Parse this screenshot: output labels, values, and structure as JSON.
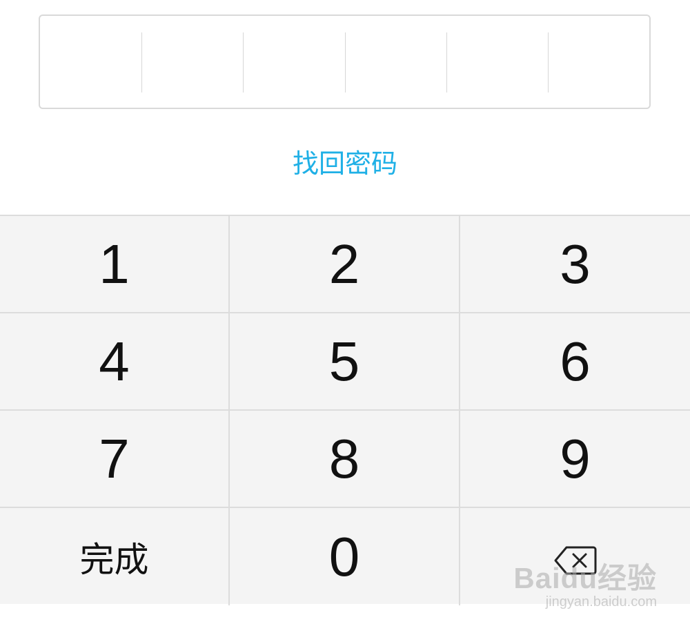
{
  "pin": {
    "cells": 6
  },
  "recover_link": "找回密码",
  "keys": {
    "k1": "1",
    "k2": "2",
    "k3": "3",
    "k4": "4",
    "k5": "5",
    "k6": "6",
    "k7": "7",
    "k8": "8",
    "k9": "9",
    "k0": "0",
    "done": "完成",
    "backspace_icon": "backspace-icon"
  },
  "watermark": {
    "main": "Baidu经验",
    "sub": "jingyan.baidu.com"
  },
  "colors": {
    "link": "#1fb0e6",
    "keypad_bg": "#f4f4f4",
    "divider": "#dcdcdc"
  }
}
